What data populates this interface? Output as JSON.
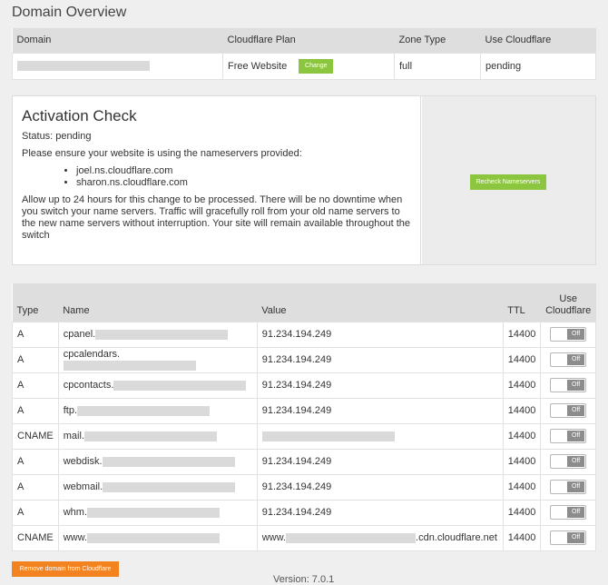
{
  "page": {
    "title": "Domain Overview",
    "version": "Version: 7.0.1"
  },
  "overview": {
    "headers": [
      "Domain",
      "Cloudflare Plan",
      "Zone Type",
      "Use Cloudflare"
    ],
    "plan": "Free Website",
    "change_label": "Change",
    "zone_type": "full",
    "use_cloudflare": "pending"
  },
  "activation": {
    "title": "Activation Check",
    "status": "Status: pending",
    "instruction": "Please ensure your website is using the nameservers provided:",
    "nameservers": [
      "joel.ns.cloudflare.com",
      "sharon.ns.cloudflare.com"
    ],
    "note": "Allow up to 24 hours for this change to be processed. There will be no downtime when you switch your name servers. Traffic will gracefully roll from your old name servers to the new name servers without interruption. Your site will remain available throughout the switch",
    "recheck_label": "Recheck Nameservers"
  },
  "dns": {
    "headers": {
      "type": "Type",
      "name": "Name",
      "value": "Value",
      "ttl": "TTL",
      "use_cf_line1": "Use",
      "use_cf_line2": "Cloudflare"
    },
    "toggle_label": "Off",
    "records": [
      {
        "type": "A",
        "name": "cpanel.",
        "value": "91.234.194.249",
        "ttl": "14400"
      },
      {
        "type": "A",
        "name": "cpcalendars.",
        "value": "91.234.194.249",
        "ttl": "14400"
      },
      {
        "type": "A",
        "name": "cpcontacts.",
        "value": "91.234.194.249",
        "ttl": "14400"
      },
      {
        "type": "A",
        "name": "ftp.",
        "value": "91.234.194.249",
        "ttl": "14400"
      },
      {
        "type": "CNAME",
        "name": "mail.",
        "value": "",
        "ttl": "14400"
      },
      {
        "type": "A",
        "name": "webdisk.",
        "value": "91.234.194.249",
        "ttl": "14400"
      },
      {
        "type": "A",
        "name": "webmail.",
        "value": "91.234.194.249",
        "ttl": "14400"
      },
      {
        "type": "A",
        "name": "whm.",
        "value": "91.234.194.249",
        "ttl": "14400"
      },
      {
        "type": "CNAME",
        "name": "www.",
        "value": "www.",
        "value_suffix": ".cdn.cloudflare.net",
        "ttl": "14400"
      }
    ]
  },
  "remove_label": "Remove domain from Cloudflare",
  "colors": {
    "green": "#8cc63f",
    "orange": "#f2831f",
    "toggle": "#8c8c8c"
  }
}
